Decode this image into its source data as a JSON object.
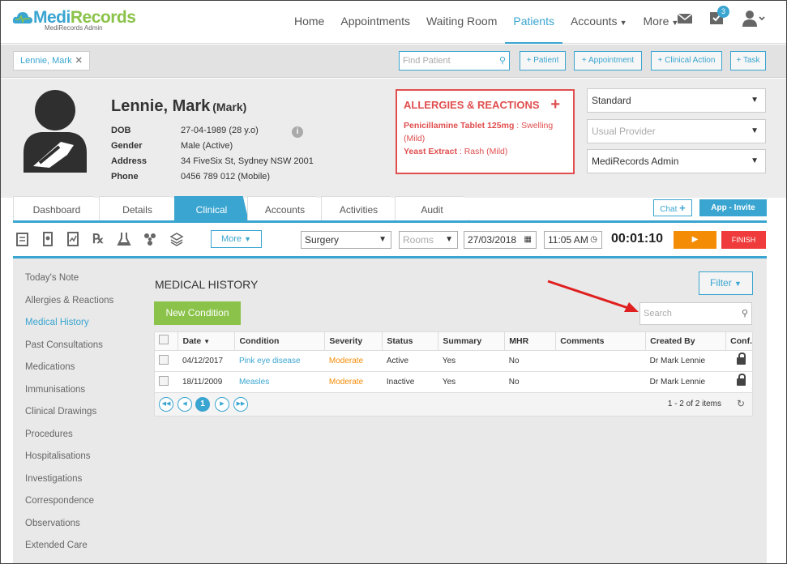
{
  "brand": {
    "name_part1": "Medi",
    "name_part2": "Records",
    "subtitle": "MediRecords Admin"
  },
  "nav": {
    "items": [
      {
        "label": "Home",
        "active": false,
        "caret": false
      },
      {
        "label": "Appointments",
        "active": false,
        "caret": false
      },
      {
        "label": "Waiting Room",
        "active": false,
        "caret": false
      },
      {
        "label": "Patients",
        "active": true,
        "caret": false
      },
      {
        "label": "Accounts",
        "active": false,
        "caret": true
      },
      {
        "label": "More",
        "active": false,
        "caret": true
      }
    ],
    "task_badge": "3",
    "icons": [
      "mail-icon",
      "tasks-icon",
      "user-icon"
    ]
  },
  "bar2": {
    "patient_tab": "Lennie, Mark",
    "find_placeholder": "Find Patient",
    "buttons": [
      "+ Patient",
      "+ Appointment",
      "+ Clinical Action",
      "+ Task"
    ]
  },
  "patient": {
    "name": "Lennie, Mark",
    "preferred": "(Mark)",
    "fields": [
      {
        "label": "DOB",
        "value": "27-04-1989 (28 y.o)"
      },
      {
        "label": "Gender",
        "value": "Male (Active)"
      },
      {
        "label": "Address",
        "value": "34 FiveSix St, Sydney NSW 2001"
      },
      {
        "label": "Phone",
        "value": "0456 789 012 (Mobile)"
      }
    ]
  },
  "allergies": {
    "title": "ALLERGIES & REACTIONS",
    "items": [
      {
        "name": "Penicillamine Tablet 125mg",
        "reaction": " : Swelling (Mild)"
      },
      {
        "name": "Yeast Extract",
        "reaction": " : Rash (Mild)"
      }
    ]
  },
  "selects": {
    "type": "Standard",
    "provider_placeholder": "Usual Provider",
    "user": "MediRecords Admin"
  },
  "tabs": [
    "Dashboard",
    "Details",
    "Clinical",
    "Accounts",
    "Activities",
    "Audit"
  ],
  "active_tab": "Clinical",
  "chat_label": "Chat",
  "invite_label": "App - Invite",
  "toolbar": {
    "icons": [
      "note-icon",
      "script-icon",
      "chart-icon",
      "rx-icon",
      "lab-icon",
      "radiation-icon",
      "stack-icon"
    ],
    "more_label": "More",
    "location": "Surgery",
    "rooms": "Rooms",
    "date": "27/03/2018",
    "time": "11:05 AM",
    "timer": "00:01:10",
    "finish_label": "FINISH"
  },
  "sidenav": [
    "Today's Note",
    "Allergies & Reactions",
    "Medical History",
    "Past Consultations",
    "Medications",
    "Immunisations",
    "Clinical Drawings",
    "Procedures",
    "Hospitalisations",
    "Investigations",
    "Correspondence",
    "Observations",
    "Extended Care"
  ],
  "sidenav_active": "Medical History",
  "medical_history": {
    "title": "MEDICAL HISTORY",
    "new_button": "New Condition",
    "filter_label": "Filter",
    "search_placeholder": "Search",
    "columns": [
      "Date",
      "Condition",
      "Severity",
      "Status",
      "Summary",
      "MHR",
      "Comments",
      "Created By",
      "Conf."
    ],
    "rows": [
      {
        "date": "04/12/2017",
        "condition": "Pink eye disease",
        "severity": "Moderate",
        "status": "Active",
        "summary": "Yes",
        "mhr": "No",
        "comments": "",
        "created_by": "Dr Mark Lennie"
      },
      {
        "date": "18/11/2009",
        "condition": "Measles",
        "severity": "Moderate",
        "status": "Inactive",
        "summary": "Yes",
        "mhr": "No",
        "comments": "",
        "created_by": "Dr Mark Lennie"
      }
    ],
    "page": "1",
    "page_info": "1 - 2 of 2 items"
  },
  "colors": {
    "accent": "#3aa5d0",
    "green": "#8bc34a",
    "alert": "#e04e4e",
    "orange": "#f48c06"
  }
}
